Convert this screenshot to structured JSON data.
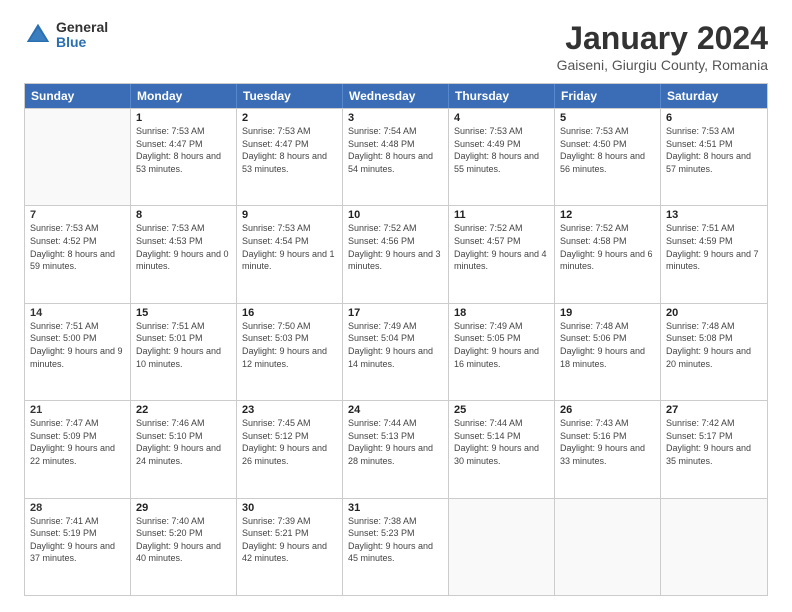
{
  "logo": {
    "general": "General",
    "blue": "Blue"
  },
  "header": {
    "month": "January 2024",
    "location": "Gaiseni, Giurgiu County, Romania"
  },
  "weekdays": [
    "Sunday",
    "Monday",
    "Tuesday",
    "Wednesday",
    "Thursday",
    "Friday",
    "Saturday"
  ],
  "weeks": [
    [
      {
        "day": "",
        "empty": true
      },
      {
        "day": "1",
        "sunrise": "7:53 AM",
        "sunset": "4:47 PM",
        "daylight": "8 hours and 53 minutes."
      },
      {
        "day": "2",
        "sunrise": "7:53 AM",
        "sunset": "4:47 PM",
        "daylight": "8 hours and 53 minutes."
      },
      {
        "day": "3",
        "sunrise": "7:54 AM",
        "sunset": "4:48 PM",
        "daylight": "8 hours and 54 minutes."
      },
      {
        "day": "4",
        "sunrise": "7:53 AM",
        "sunset": "4:49 PM",
        "daylight": "8 hours and 55 minutes."
      },
      {
        "day": "5",
        "sunrise": "7:53 AM",
        "sunset": "4:50 PM",
        "daylight": "8 hours and 56 minutes."
      },
      {
        "day": "6",
        "sunrise": "7:53 AM",
        "sunset": "4:51 PM",
        "daylight": "8 hours and 57 minutes."
      }
    ],
    [
      {
        "day": "7",
        "sunrise": "7:53 AM",
        "sunset": "4:52 PM",
        "daylight": "8 hours and 59 minutes."
      },
      {
        "day": "8",
        "sunrise": "7:53 AM",
        "sunset": "4:53 PM",
        "daylight": "9 hours and 0 minutes."
      },
      {
        "day": "9",
        "sunrise": "7:53 AM",
        "sunset": "4:54 PM",
        "daylight": "9 hours and 1 minute."
      },
      {
        "day": "10",
        "sunrise": "7:52 AM",
        "sunset": "4:56 PM",
        "daylight": "9 hours and 3 minutes."
      },
      {
        "day": "11",
        "sunrise": "7:52 AM",
        "sunset": "4:57 PM",
        "daylight": "9 hours and 4 minutes."
      },
      {
        "day": "12",
        "sunrise": "7:52 AM",
        "sunset": "4:58 PM",
        "daylight": "9 hours and 6 minutes."
      },
      {
        "day": "13",
        "sunrise": "7:51 AM",
        "sunset": "4:59 PM",
        "daylight": "9 hours and 7 minutes."
      }
    ],
    [
      {
        "day": "14",
        "sunrise": "7:51 AM",
        "sunset": "5:00 PM",
        "daylight": "9 hours and 9 minutes."
      },
      {
        "day": "15",
        "sunrise": "7:51 AM",
        "sunset": "5:01 PM",
        "daylight": "9 hours and 10 minutes."
      },
      {
        "day": "16",
        "sunrise": "7:50 AM",
        "sunset": "5:03 PM",
        "daylight": "9 hours and 12 minutes."
      },
      {
        "day": "17",
        "sunrise": "7:49 AM",
        "sunset": "5:04 PM",
        "daylight": "9 hours and 14 minutes."
      },
      {
        "day": "18",
        "sunrise": "7:49 AM",
        "sunset": "5:05 PM",
        "daylight": "9 hours and 16 minutes."
      },
      {
        "day": "19",
        "sunrise": "7:48 AM",
        "sunset": "5:06 PM",
        "daylight": "9 hours and 18 minutes."
      },
      {
        "day": "20",
        "sunrise": "7:48 AM",
        "sunset": "5:08 PM",
        "daylight": "9 hours and 20 minutes."
      }
    ],
    [
      {
        "day": "21",
        "sunrise": "7:47 AM",
        "sunset": "5:09 PM",
        "daylight": "9 hours and 22 minutes."
      },
      {
        "day": "22",
        "sunrise": "7:46 AM",
        "sunset": "5:10 PM",
        "daylight": "9 hours and 24 minutes."
      },
      {
        "day": "23",
        "sunrise": "7:45 AM",
        "sunset": "5:12 PM",
        "daylight": "9 hours and 26 minutes."
      },
      {
        "day": "24",
        "sunrise": "7:44 AM",
        "sunset": "5:13 PM",
        "daylight": "9 hours and 28 minutes."
      },
      {
        "day": "25",
        "sunrise": "7:44 AM",
        "sunset": "5:14 PM",
        "daylight": "9 hours and 30 minutes."
      },
      {
        "day": "26",
        "sunrise": "7:43 AM",
        "sunset": "5:16 PM",
        "daylight": "9 hours and 33 minutes."
      },
      {
        "day": "27",
        "sunrise": "7:42 AM",
        "sunset": "5:17 PM",
        "daylight": "9 hours and 35 minutes."
      }
    ],
    [
      {
        "day": "28",
        "sunrise": "7:41 AM",
        "sunset": "5:19 PM",
        "daylight": "9 hours and 37 minutes."
      },
      {
        "day": "29",
        "sunrise": "7:40 AM",
        "sunset": "5:20 PM",
        "daylight": "9 hours and 40 minutes."
      },
      {
        "day": "30",
        "sunrise": "7:39 AM",
        "sunset": "5:21 PM",
        "daylight": "9 hours and 42 minutes."
      },
      {
        "day": "31",
        "sunrise": "7:38 AM",
        "sunset": "5:23 PM",
        "daylight": "9 hours and 45 minutes."
      },
      {
        "day": "",
        "empty": true
      },
      {
        "day": "",
        "empty": true
      },
      {
        "day": "",
        "empty": true
      }
    ]
  ]
}
